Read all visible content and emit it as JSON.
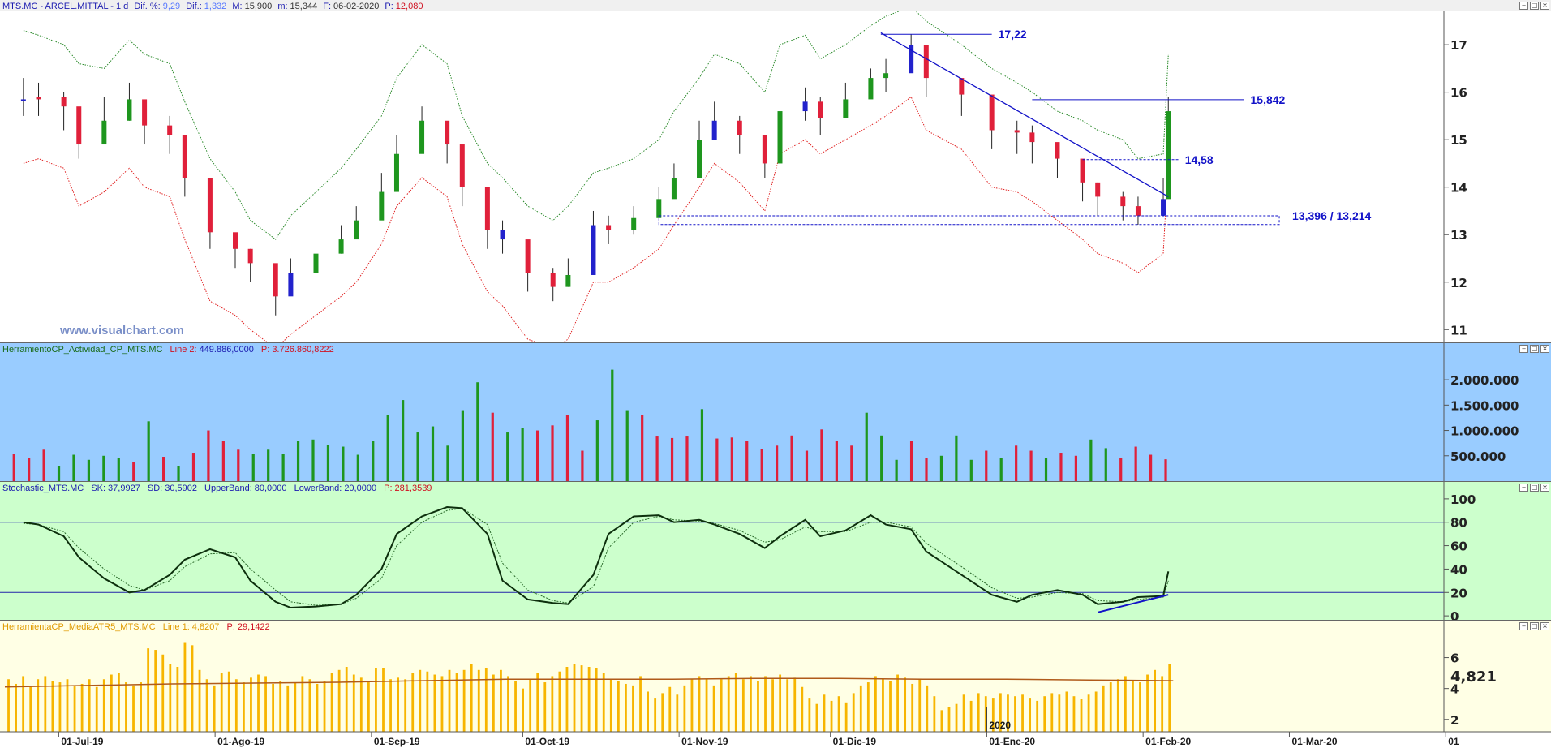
{
  "header": {
    "symbol": "MTS.MC - ARCEL.MITTAL - 1 d",
    "dif_pct_label": "Dif. %:",
    "dif_pct": "9,29",
    "dif_label": "Dif.:",
    "dif": "1,332",
    "max_label": "M:",
    "max": "15,900",
    "min_label": "m:",
    "min": "15,344",
    "date_label": "F:",
    "date": "06-02-2020",
    "price_label": "P:",
    "price": "12,080"
  },
  "panels": {
    "volume": {
      "name": "HerramientoCP_Actividad_CP_MTS.MC",
      "line_label": "Line 2:",
      "line_value": "449.886,0000",
      "p_label": "P:",
      "p_value": "3.726.860,8222"
    },
    "stochastic": {
      "name": "Stochastic_MTS.MC",
      "sk_label": "SK:",
      "sk": "37,9927",
      "sd_label": "SD:",
      "sd": "30,5902",
      "ub_label": "UpperBand:",
      "ub": "80,0000",
      "lb_label": "LowerBand:",
      "lb": "20,0000",
      "p_label": "P:",
      "p_value": "281,3539"
    },
    "atr": {
      "name": "HerramientaCP_MediaATR5_MTS.MC",
      "line_label": "Line 1:",
      "line_value": "4,8207",
      "p_label": "P:",
      "p_value": "29,1422",
      "last_label": "4,821"
    }
  },
  "watermark": "www.visualchart.com",
  "x_ticks": [
    "01-Jul-19",
    "01-Ago-19",
    "01-Sep-19",
    "01-Oct-19",
    "01-Nov-19",
    "01-Dic-19",
    "01-Ene-20",
    "01-Feb-20",
    "01-Mar-20",
    "01"
  ],
  "year_marker": "2020",
  "colors": {
    "bull": "#1e961e",
    "bear": "#e0203a",
    "neutral": "#2222cc",
    "upper_band": "#2a8a2a",
    "lower_band": "#e02020",
    "vol_bg": "#99ccff",
    "stoch_bg": "#ccffcc",
    "atr_bg": "#ffffe5",
    "atr_bar": "#f7b500",
    "atr_line": "#b05a1a",
    "annotation": "#1212c8"
  },
  "chart_data": [
    {
      "type": "candlestick",
      "title": "MTS.MC - ARCEL.MITTAL - 1 d",
      "y_ticks": [
        "11",
        "12",
        "13",
        "14",
        "15",
        "16",
        "17"
      ],
      "ylim": [
        10.8,
        17.6
      ],
      "x_range": [
        "2019-06-20",
        "2020-03-31"
      ],
      "dates": [
        "2019-06-24",
        "2019-06-27",
        "2019-07-02",
        "2019-07-05",
        "2019-07-10",
        "2019-07-15",
        "2019-07-18",
        "2019-07-23",
        "2019-07-26",
        "2019-07-31",
        "2019-08-05",
        "2019-08-08",
        "2019-08-13",
        "2019-08-16",
        "2019-08-21",
        "2019-08-26",
        "2019-08-29",
        "2019-09-03",
        "2019-09-06",
        "2019-09-11",
        "2019-09-16",
        "2019-09-19",
        "2019-09-24",
        "2019-09-27",
        "2019-10-02",
        "2019-10-07",
        "2019-10-10",
        "2019-10-15",
        "2019-10-18",
        "2019-10-23",
        "2019-10-28",
        "2019-10-31",
        "2019-11-05",
        "2019-11-08",
        "2019-11-13",
        "2019-11-18",
        "2019-11-21",
        "2019-11-26",
        "2019-11-29",
        "2019-12-04",
        "2019-12-09",
        "2019-12-12",
        "2019-12-17",
        "2019-12-20",
        "2019-12-27",
        "2020-01-02",
        "2020-01-07",
        "2020-01-10",
        "2020-01-15",
        "2020-01-20",
        "2020-01-23",
        "2020-01-28",
        "2020-01-31",
        "2020-02-05",
        "2020-02-06"
      ],
      "close": [
        15.85,
        15.9,
        15.7,
        14.9,
        15.4,
        15.85,
        15.3,
        15.1,
        14.2,
        13.05,
        12.7,
        12.4,
        11.7,
        12.2,
        12.6,
        12.9,
        13.3,
        13.9,
        14.7,
        15.4,
        14.9,
        14.0,
        13.1,
        12.9,
        12.2,
        11.9,
        12.15,
        13.2,
        13.1,
        13.35,
        13.75,
        14.2,
        15.0,
        15.4,
        15.1,
        14.5,
        15.6,
        15.8,
        15.45,
        15.85,
        16.3,
        16.4,
        17.0,
        16.3,
        15.95,
        15.2,
        15.15,
        14.95,
        14.6,
        14.1,
        13.8,
        13.6,
        13.4,
        13.75,
        15.6
      ],
      "high": [
        16.3,
        16.2,
        16.0,
        15.4,
        15.9,
        16.2,
        15.7,
        15.5,
        14.6,
        13.5,
        13.0,
        12.7,
        12.1,
        12.5,
        12.9,
        13.2,
        13.6,
        14.3,
        15.1,
        15.7,
        15.3,
        14.5,
        13.5,
        13.3,
        12.6,
        12.3,
        12.5,
        13.5,
        13.4,
        13.6,
        14.0,
        14.5,
        15.4,
        15.8,
        15.5,
        15.0,
        16.0,
        16.1,
        15.9,
        16.2,
        16.5,
        16.7,
        17.22,
        16.6,
        16.2,
        15.6,
        15.4,
        15.3,
        14.9,
        14.4,
        14.1,
        13.9,
        13.8,
        14.2,
        15.9
      ],
      "low": [
        15.5,
        15.5,
        15.2,
        14.6,
        15.0,
        15.4,
        14.9,
        14.7,
        13.8,
        12.7,
        12.3,
        12.0,
        11.3,
        11.9,
        12.3,
        12.6,
        13.0,
        13.6,
        14.4,
        15.0,
        14.5,
        13.6,
        12.7,
        12.6,
        11.8,
        11.6,
        11.9,
        12.8,
        12.8,
        13.0,
        13.4,
        13.8,
        14.6,
        15.0,
        14.7,
        14.2,
        15.2,
        15.4,
        15.1,
        15.5,
        15.9,
        16.0,
        16.5,
        15.9,
        15.5,
        14.8,
        14.7,
        14.5,
        14.2,
        13.7,
        13.4,
        13.3,
        13.21,
        13.4,
        15.34
      ],
      "direction": [
        "neutral",
        "bear",
        "bear",
        "bear",
        "bull",
        "bull",
        "bear",
        "bear",
        "bear",
        "bear",
        "bear",
        "bear",
        "bear",
        "neutral",
        "bull",
        "bull",
        "bull",
        "bull",
        "bull",
        "bull",
        "bear",
        "bear",
        "bear",
        "neutral",
        "bear",
        "bear",
        "bull",
        "neutral",
        "bear",
        "bull",
        "bull",
        "bull",
        "bull",
        "neutral",
        "bear",
        "bear",
        "bull",
        "neutral",
        "bear",
        "bull",
        "bull",
        "bull",
        "neutral",
        "bear",
        "bear",
        "bear",
        "bear",
        "bear",
        "bear",
        "bear",
        "bear",
        "bear",
        "bear",
        "neutral",
        "bull"
      ],
      "upper_band": [
        17.3,
        17.2,
        17.0,
        16.6,
        16.5,
        17.1,
        16.8,
        16.6,
        15.8,
        14.6,
        13.9,
        13.3,
        12.9,
        13.4,
        13.9,
        14.4,
        14.8,
        15.5,
        16.3,
        17.0,
        16.6,
        15.5,
        14.5,
        14.2,
        13.6,
        13.3,
        13.6,
        14.3,
        14.4,
        14.6,
        15.0,
        15.6,
        16.3,
        16.8,
        16.6,
        16.0,
        17.0,
        17.2,
        16.7,
        17.0,
        17.4,
        17.6,
        17.8,
        17.5,
        17.0,
        16.5,
        16.2,
        16.0,
        15.6,
        15.4,
        15.2,
        15.0,
        14.6,
        14.7,
        16.8
      ],
      "lower_band": [
        14.5,
        14.6,
        14.4,
        13.6,
        13.9,
        14.4,
        14.0,
        13.8,
        12.9,
        11.6,
        11.3,
        11.0,
        10.6,
        10.9,
        11.3,
        11.7,
        12.0,
        12.8,
        13.6,
        14.2,
        13.8,
        12.8,
        11.8,
        11.5,
        10.8,
        10.6,
        10.8,
        12.0,
        12.0,
        12.3,
        12.7,
        13.2,
        14.0,
        14.5,
        14.1,
        13.5,
        14.7,
        15.0,
        14.7,
        15.0,
        15.3,
        15.5,
        15.9,
        15.2,
        14.8,
        14.0,
        13.9,
        13.7,
        13.3,
        12.9,
        12.6,
        12.4,
        12.2,
        12.6,
        14.6
      ],
      "annotations": {
        "resistance_high": {
          "value": 17.22,
          "label": "17,22",
          "from": "2019-12-11",
          "to": "2020-01-02"
        },
        "resistance": {
          "value": 15.842,
          "label": "15,842",
          "from": "2020-01-10",
          "to": "2020-02-21"
        },
        "breakout_level": {
          "value": 14.58,
          "label": "14,58",
          "from": "2020-01-20",
          "to": "2020-02-08"
        },
        "support_band": {
          "value_top": 13.396,
          "value_bottom": 13.214,
          "label": "13,396 / 13,214",
          "from": "2019-10-28",
          "to": "2020-02-28"
        },
        "downtrend": {
          "from_date": "2019-12-11",
          "from_value": 17.25,
          "to_date": "2020-02-06",
          "to_value": 13.8
        }
      }
    },
    {
      "type": "bar",
      "title": "HerramientoCP_Actividad_CP_MTS.MC",
      "y_ticks": [
        "500.000",
        "1.000.000",
        "1.500.000",
        "2.000.000"
      ],
      "ylim": [
        0,
        2450000
      ],
      "values": [
        530000,
        460000,
        620000,
        300000,
        520000,
        420000,
        500000,
        450000,
        380000,
        1180000,
        480000,
        300000,
        560000,
        1000000,
        800000,
        620000,
        540000,
        620000,
        540000,
        800000,
        820000,
        720000,
        680000,
        520000,
        800000,
        1300000,
        1600000,
        960000,
        1080000,
        700000,
        1400000,
        1950000,
        1350000,
        960000,
        1050000,
        1000000,
        1100000,
        1300000,
        600000,
        1200000,
        2200000,
        1400000,
        1300000,
        880000,
        850000,
        880000,
        1420000,
        840000,
        860000,
        800000,
        630000,
        700000,
        900000,
        600000,
        1020000,
        800000,
        700000,
        1350000,
        900000,
        420000,
        800000,
        450000,
        500000,
        900000,
        420000,
        600000,
        450000,
        700000,
        600000,
        450000,
        560000,
        500000,
        820000,
        650000,
        460000,
        680000,
        520000,
        430000
      ],
      "colors": [
        "bear",
        "bear",
        "bear",
        "bull",
        "bull",
        "bull",
        "bull",
        "bull",
        "bear",
        "bull",
        "bear",
        "bull",
        "bear",
        "bear",
        "bear",
        "bear",
        "bull",
        "bull",
        "bull",
        "bull",
        "bull",
        "bull",
        "bull",
        "bull",
        "bull",
        "bull",
        "bull",
        "bull",
        "bull",
        "bull",
        "bull",
        "bull",
        "bear",
        "bull",
        "bull",
        "bear",
        "bear",
        "bear",
        "bear",
        "bull",
        "bull",
        "bull",
        "bear",
        "bear",
        "bear",
        "bear",
        "bull",
        "bear",
        "bear",
        "bear",
        "bear",
        "bear",
        "bear",
        "bear",
        "bear",
        "bear",
        "bear",
        "bull",
        "bull",
        "bull",
        "bear",
        "bear",
        "bull",
        "bull",
        "bull",
        "bear",
        "bull",
        "bear",
        "bear",
        "bull",
        "bear",
        "bear",
        "bull",
        "bull",
        "bear",
        "bear",
        "bear",
        "bear"
      ]
    },
    {
      "type": "line",
      "title": "Stochastic_MTS.MC",
      "y_ticks": [
        "0",
        "20",
        "40",
        "60",
        "80",
        "100"
      ],
      "ylim": [
        -2,
        102
      ],
      "bands": [
        80,
        20
      ],
      "series": [
        {
          "name": "SK",
          "values": [
            80,
            78,
            68,
            50,
            32,
            20,
            22,
            35,
            48,
            57,
            50,
            30,
            12,
            7,
            8,
            10,
            18,
            40,
            70,
            85,
            93,
            92,
            70,
            30,
            14,
            11,
            10,
            35,
            70,
            85,
            86,
            80,
            82,
            78,
            70,
            58,
            68,
            82,
            68,
            73,
            86,
            78,
            74,
            55,
            35,
            18,
            12,
            18,
            22,
            18,
            10,
            12,
            16,
            17,
            38
          ]
        },
        {
          "name": "SD",
          "values": [
            79,
            78,
            72,
            58,
            40,
            26,
            22,
            30,
            42,
            53,
            54,
            40,
            22,
            12,
            9,
            10,
            15,
            32,
            60,
            80,
            90,
            92,
            78,
            45,
            22,
            13,
            11,
            25,
            58,
            80,
            85,
            82,
            81,
            79,
            73,
            63,
            65,
            76,
            72,
            72,
            80,
            80,
            76,
            62,
            42,
            24,
            15,
            16,
            20,
            19,
            13,
            12,
            14,
            16,
            30
          ]
        }
      ],
      "divergence_line": {
        "from_date": "2020-01-23",
        "from_value": 3,
        "to_date": "2020-02-06",
        "to_value": 18
      }
    },
    {
      "type": "bar",
      "title": "HerramientaCP_MediaATR5_MTS.MC",
      "y_ticks": [
        "2",
        "4",
        "6"
      ],
      "ylim": [
        1.2,
        7.5
      ],
      "values": [
        4.6,
        4.3,
        4.8,
        4.1,
        4.6,
        4.8,
        4.5,
        4.4,
        4.6,
        4.2,
        4.3,
        4.6,
        4.1,
        4.6,
        4.9,
        5.0,
        4.4,
        4.2,
        4.4,
        6.6,
        6.5,
        6.2,
        5.6,
        5.4,
        7.0,
        6.8,
        5.2,
        4.6,
        4.2,
        5.0,
        5.1,
        4.6,
        4.4,
        4.7,
        4.9,
        4.8,
        4.3,
        4.5,
        4.2,
        4.4,
        4.8,
        4.6,
        4.3,
        4.5,
        5.0,
        5.2,
        5.4,
        4.9,
        4.7,
        4.4,
        5.3,
        5.3,
        4.6,
        4.7,
        4.6,
        5.0,
        5.2,
        5.1,
        4.9,
        4.8,
        5.2,
        5.0,
        5.2,
        5.6,
        5.2,
        5.3,
        4.9,
        5.2,
        4.8,
        4.5,
        4.0,
        4.6,
        5.0,
        4.4,
        4.8,
        5.1,
        5.4,
        5.6,
        5.5,
        5.4,
        5.3,
        5.0,
        4.6,
        4.5,
        4.3,
        4.2,
        4.8,
        3.8,
        3.4,
        3.7,
        4.1,
        3.6,
        4.2,
        4.6,
        4.8,
        4.6,
        4.2,
        4.6,
        4.8,
        5.0,
        4.6,
        4.8,
        4.5,
        4.8,
        4.6,
        4.9,
        4.6,
        4.7,
        4.1,
        3.4,
        3.0,
        3.6,
        3.2,
        3.5,
        3.1,
        3.7,
        4.2,
        4.4,
        4.8,
        4.6,
        4.5,
        4.9,
        4.7,
        4.3,
        4.6,
        4.2,
        3.5,
        2.6,
        2.8,
        3.0,
        3.6,
        3.2,
        3.7,
        3.5,
        3.4,
        3.7,
        3.6,
        3.5,
        3.6,
        3.4,
        3.2,
        3.5,
        3.7,
        3.6,
        3.8,
        3.5,
        3.3,
        3.6,
        3.8,
        4.2,
        4.4,
        4.6,
        4.8,
        4.5,
        4.4,
        4.9,
        5.2,
        4.8,
        5.6
      ],
      "line": [
        4.1,
        4.2,
        4.3,
        4.35,
        4.4,
        4.5,
        4.6,
        4.6,
        4.6,
        4.65,
        4.65,
        4.6,
        4.6,
        4.55,
        4.5
      ],
      "last_value": 4.821
    }
  ]
}
